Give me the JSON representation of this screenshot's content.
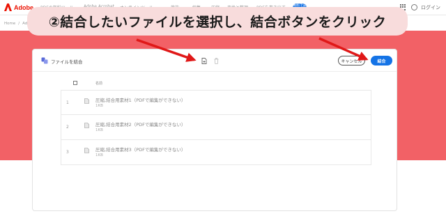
{
  "nav": {
    "brand": "Adobe",
    "items": [
      "PDFの無料ツール",
      "Adobe Acrobat",
      "オンラインツール",
      "機能",
      "編集",
      "圧縮",
      "変換と整理",
      "PDFを書き出す"
    ],
    "cta": "無料で試す",
    "login": "ログイン"
  },
  "breadcrumb": [
    "Home",
    "/",
    "Adobe"
  ],
  "instruction": "②結合したいファイルを選択し、結合ボタンをクリック",
  "panel": {
    "title": "ファイルを結合",
    "cancel_label": "キャンセル",
    "merge_label": "結合",
    "column_name": "名前"
  },
  "files": [
    {
      "index": "1",
      "name": "圧縮,結合用素材1（PDFで編集ができない）",
      "size": "1KB"
    },
    {
      "index": "2",
      "name": "圧縮,結合用素材2（PDFで編集ができない）",
      "size": "1KB"
    },
    {
      "index": "3",
      "name": "圧縮,結合用素材3（PDFで編集ができない）",
      "size": "1KB"
    }
  ],
  "colors": {
    "banner": "#f26166",
    "callout": "#f8dcdc",
    "accent": "#1473e6",
    "arrow": "#e01818"
  }
}
